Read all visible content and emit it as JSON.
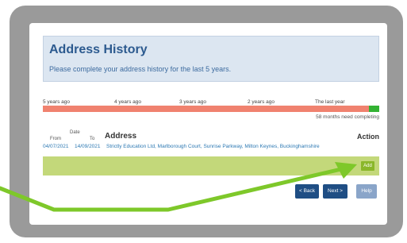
{
  "header": {
    "title": "Address History",
    "subtitle": "Please complete your address history for the last 5 years."
  },
  "timeline": {
    "labels": [
      "5 years ago",
      "4 years ago",
      "3 years ago",
      "2 years ago",
      "The last year"
    ],
    "completed_fraction": 0.03,
    "remaining_text": "58 months need completing",
    "colors": {
      "remaining": "#f0826f",
      "completed": "#33b233"
    }
  },
  "table": {
    "date_label": "Date",
    "from_label": "From",
    "to_label": "To",
    "address_label": "Address",
    "action_label": "Action",
    "rows": [
      {
        "from": "04/07/2021",
        "to": "14/09/2021",
        "address": "Strictly Education Ltd, Marlborough Court, Sunrise Parkway, Milton Keynes, Buckinghamshire"
      }
    ]
  },
  "buttons": {
    "add": "Add",
    "back": "< Back",
    "next": "Next >",
    "help": "Help"
  },
  "annotation": {
    "arrow_color": "#7ec82a",
    "points_to": "add-button"
  }
}
